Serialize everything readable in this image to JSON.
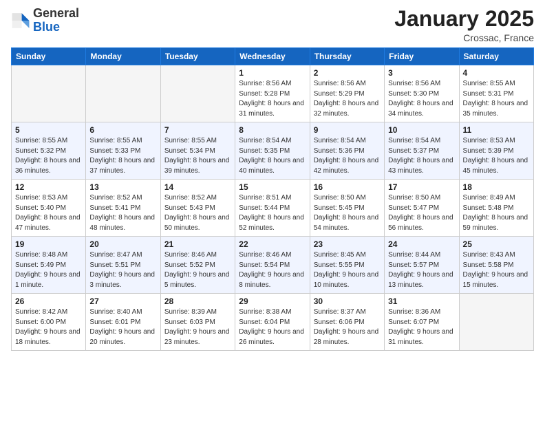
{
  "header": {
    "logo_general": "General",
    "logo_blue": "Blue",
    "title": "January 2025",
    "subtitle": "Crossac, France"
  },
  "days_of_week": [
    "Sunday",
    "Monday",
    "Tuesday",
    "Wednesday",
    "Thursday",
    "Friday",
    "Saturday"
  ],
  "weeks": [
    [
      {
        "day": "",
        "empty": true
      },
      {
        "day": "",
        "empty": true
      },
      {
        "day": "",
        "empty": true
      },
      {
        "day": "1",
        "sunrise": "8:56 AM",
        "sunset": "5:28 PM",
        "daylight": "8 hours and 31 minutes."
      },
      {
        "day": "2",
        "sunrise": "8:56 AM",
        "sunset": "5:29 PM",
        "daylight": "8 hours and 32 minutes."
      },
      {
        "day": "3",
        "sunrise": "8:56 AM",
        "sunset": "5:30 PM",
        "daylight": "8 hours and 34 minutes."
      },
      {
        "day": "4",
        "sunrise": "8:55 AM",
        "sunset": "5:31 PM",
        "daylight": "8 hours and 35 minutes."
      }
    ],
    [
      {
        "day": "5",
        "sunrise": "8:55 AM",
        "sunset": "5:32 PM",
        "daylight": "8 hours and 36 minutes."
      },
      {
        "day": "6",
        "sunrise": "8:55 AM",
        "sunset": "5:33 PM",
        "daylight": "8 hours and 37 minutes."
      },
      {
        "day": "7",
        "sunrise": "8:55 AM",
        "sunset": "5:34 PM",
        "daylight": "8 hours and 39 minutes."
      },
      {
        "day": "8",
        "sunrise": "8:54 AM",
        "sunset": "5:35 PM",
        "daylight": "8 hours and 40 minutes."
      },
      {
        "day": "9",
        "sunrise": "8:54 AM",
        "sunset": "5:36 PM",
        "daylight": "8 hours and 42 minutes."
      },
      {
        "day": "10",
        "sunrise": "8:54 AM",
        "sunset": "5:37 PM",
        "daylight": "8 hours and 43 minutes."
      },
      {
        "day": "11",
        "sunrise": "8:53 AM",
        "sunset": "5:39 PM",
        "daylight": "8 hours and 45 minutes."
      }
    ],
    [
      {
        "day": "12",
        "sunrise": "8:53 AM",
        "sunset": "5:40 PM",
        "daylight": "8 hours and 47 minutes."
      },
      {
        "day": "13",
        "sunrise": "8:52 AM",
        "sunset": "5:41 PM",
        "daylight": "8 hours and 48 minutes."
      },
      {
        "day": "14",
        "sunrise": "8:52 AM",
        "sunset": "5:43 PM",
        "daylight": "8 hours and 50 minutes."
      },
      {
        "day": "15",
        "sunrise": "8:51 AM",
        "sunset": "5:44 PM",
        "daylight": "8 hours and 52 minutes."
      },
      {
        "day": "16",
        "sunrise": "8:50 AM",
        "sunset": "5:45 PM",
        "daylight": "8 hours and 54 minutes."
      },
      {
        "day": "17",
        "sunrise": "8:50 AM",
        "sunset": "5:47 PM",
        "daylight": "8 hours and 56 minutes."
      },
      {
        "day": "18",
        "sunrise": "8:49 AM",
        "sunset": "5:48 PM",
        "daylight": "8 hours and 59 minutes."
      }
    ],
    [
      {
        "day": "19",
        "sunrise": "8:48 AM",
        "sunset": "5:49 PM",
        "daylight": "9 hours and 1 minute."
      },
      {
        "day": "20",
        "sunrise": "8:47 AM",
        "sunset": "5:51 PM",
        "daylight": "9 hours and 3 minutes."
      },
      {
        "day": "21",
        "sunrise": "8:46 AM",
        "sunset": "5:52 PM",
        "daylight": "9 hours and 5 minutes."
      },
      {
        "day": "22",
        "sunrise": "8:46 AM",
        "sunset": "5:54 PM",
        "daylight": "9 hours and 8 minutes."
      },
      {
        "day": "23",
        "sunrise": "8:45 AM",
        "sunset": "5:55 PM",
        "daylight": "9 hours and 10 minutes."
      },
      {
        "day": "24",
        "sunrise": "8:44 AM",
        "sunset": "5:57 PM",
        "daylight": "9 hours and 13 minutes."
      },
      {
        "day": "25",
        "sunrise": "8:43 AM",
        "sunset": "5:58 PM",
        "daylight": "9 hours and 15 minutes."
      }
    ],
    [
      {
        "day": "26",
        "sunrise": "8:42 AM",
        "sunset": "6:00 PM",
        "daylight": "9 hours and 18 minutes."
      },
      {
        "day": "27",
        "sunrise": "8:40 AM",
        "sunset": "6:01 PM",
        "daylight": "9 hours and 20 minutes."
      },
      {
        "day": "28",
        "sunrise": "8:39 AM",
        "sunset": "6:03 PM",
        "daylight": "9 hours and 23 minutes."
      },
      {
        "day": "29",
        "sunrise": "8:38 AM",
        "sunset": "6:04 PM",
        "daylight": "9 hours and 26 minutes."
      },
      {
        "day": "30",
        "sunrise": "8:37 AM",
        "sunset": "6:06 PM",
        "daylight": "9 hours and 28 minutes."
      },
      {
        "day": "31",
        "sunrise": "8:36 AM",
        "sunset": "6:07 PM",
        "daylight": "9 hours and 31 minutes."
      },
      {
        "day": "",
        "empty": true
      }
    ]
  ]
}
